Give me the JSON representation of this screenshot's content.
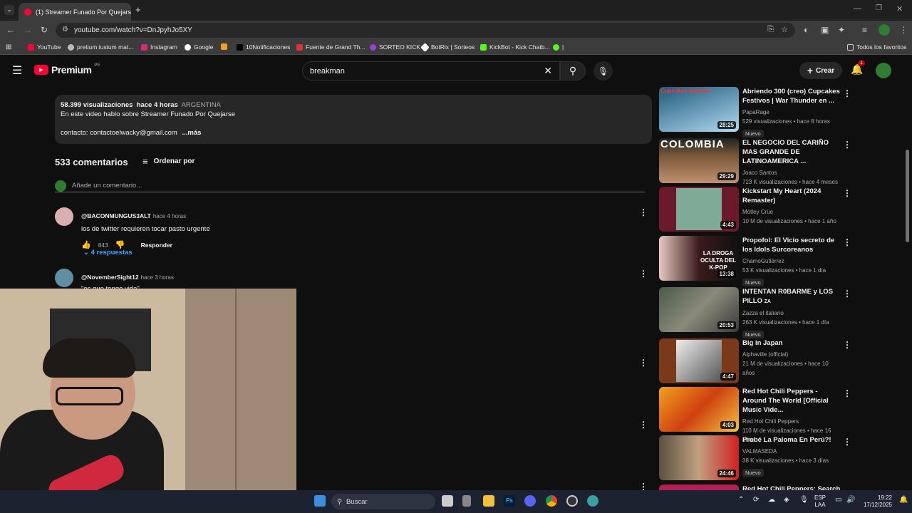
{
  "browser": {
    "tab_title": "(1) Streamer Funado Por Quejarse",
    "url": "youtube.com/watch?v=DnJpyhJo5XY",
    "bookmarks": [
      {
        "label": "YouTube",
        "color": "#ff0033"
      },
      {
        "label": "pretium iustum mat...",
        "color": "#8a8a8a"
      },
      {
        "label": "Instagram",
        "color": "#d62976"
      },
      {
        "label": "Google",
        "color": "#4285f4"
      },
      {
        "label": "",
        "color": "#f0a020"
      },
      {
        "label": "10Notificaciones",
        "color": "#000000"
      },
      {
        "label": "Fuente de Grand Th...",
        "color": "#d33"
      },
      {
        "label": "SORTEO KICK",
        "color": "#a23cd6"
      },
      {
        "label": "BotRix | Sorteos",
        "color": "#ffffff"
      },
      {
        "label": "KickBot - Kick Chatb...",
        "color": "#53fc18"
      },
      {
        "label": "|",
        "color": "#53fc18"
      }
    ],
    "all_bookmarks": "Todos los favoritos"
  },
  "header": {
    "logo": "Premium",
    "logo_sup": "PE",
    "search_query": "breakman",
    "create_label": "Crear",
    "notif_count": "1"
  },
  "description": {
    "views": "58.399 visualizaciones",
    "time": "hace 4 horas",
    "tag": "ARGENTINA",
    "line1": "En este video hablo sobre Streamer Funado Por Quejarse",
    "contact": "contacto: contactoelwacky@gmail.com",
    "more": "...más"
  },
  "comments": {
    "count": "533 comentarios",
    "sort_label": "Ordenar por",
    "add_placeholder": "Añade un comentario...",
    "items": [
      {
        "author": "@BACONMUNGUS3ALT",
        "time": "hace 4 horas",
        "text": "los de twitter requieren tocar pasto urgente",
        "likes": "843",
        "reply": "Responder",
        "replies": "4 respuestas"
      },
      {
        "author": "@NovemberSight12",
        "time": "hace 3 horas",
        "text": "\"es que tengo vida\""
      }
    ]
  },
  "recommendations": [
    {
      "title": "Abriendo 300 (creo) Cupcakes Festivos | War Thunder en ...",
      "channel": "PapaRage",
      "stats": "529 visualizaciones • hace 8 horas",
      "duration": "28:25",
      "badge": "Nuevo",
      "thumb_text": "Cupcakes festivos",
      "color": "#1d5a7a"
    },
    {
      "title": "EL NEGOCIO DEL CARIÑO MAS GRANDE DE LATINOAMERICA ...",
      "channel": "Joaco Santos",
      "stats": "723 K visualizaciones • hace 4 meses",
      "duration": "29:29",
      "badge": "",
      "thumb_text": "COLOMBIA",
      "color": "#7a5a3a"
    },
    {
      "title": "Kickstart My Heart (2024 Remaster)",
      "channel": "Mötley Crüe",
      "stats": "10 M de visualizaciones • hace 1 año",
      "duration": "4:43",
      "badge": "",
      "thumb_text": "",
      "color": "#6a1a2a"
    },
    {
      "title": "Propofol: El Vicio secreto de los Idols Surcoreanos",
      "channel": "ChamoGutiérrez",
      "stats": "53 K visualizaciones • hace 1 día",
      "duration": "13:38",
      "badge": "Nuevo",
      "thumb_text": "LA DROGA OCULTA DEL K-POP",
      "color": "#3a1a1a"
    },
    {
      "title": "INTENTAN R0BARME y LOS PILLO",
      "channel": "Zazza el italiano",
      "stats": "263 K visualizaciones • hace 1 día",
      "duration": "20:53",
      "badge": "Nuevo",
      "thumb_text": "",
      "color": "#5a6a5a",
      "title_suffix": "ZA"
    },
    {
      "title": "Big in Japan",
      "channel": "Alphaville (official)",
      "stats": "21 M de visualizaciones • hace 10 años",
      "duration": "4:47",
      "badge": "",
      "thumb_text": "",
      "color": "#7a3a1a"
    },
    {
      "title": "Red Hot Chili Peppers - Around The World [Official Music Vide...",
      "channel": "Red Hot Chili Peppers",
      "stats": "110 M de visualizaciones • hace 16 años",
      "duration": "4:03",
      "badge": "",
      "thumb_text": "",
      "color": "#d07010"
    },
    {
      "title": "Probé La Paloma En Perú?!",
      "channel": "VALMASEDA",
      "stats": "38 K visualizaciones • hace 3 días",
      "duration": "24:46",
      "badge": "Nuevo",
      "thumb_text": "",
      "color": "#4a4030"
    },
    {
      "title": "Red Hot Chili Peppers: Search",
      "channel": "",
      "stats": "",
      "duration": "",
      "badge": "",
      "thumb_text": "",
      "color": "#b02050"
    }
  ],
  "taskbar": {
    "search": "Buscar",
    "lang1": "ESP",
    "lang2": "LAA",
    "time": "19:22",
    "date": "17/12/2025"
  }
}
